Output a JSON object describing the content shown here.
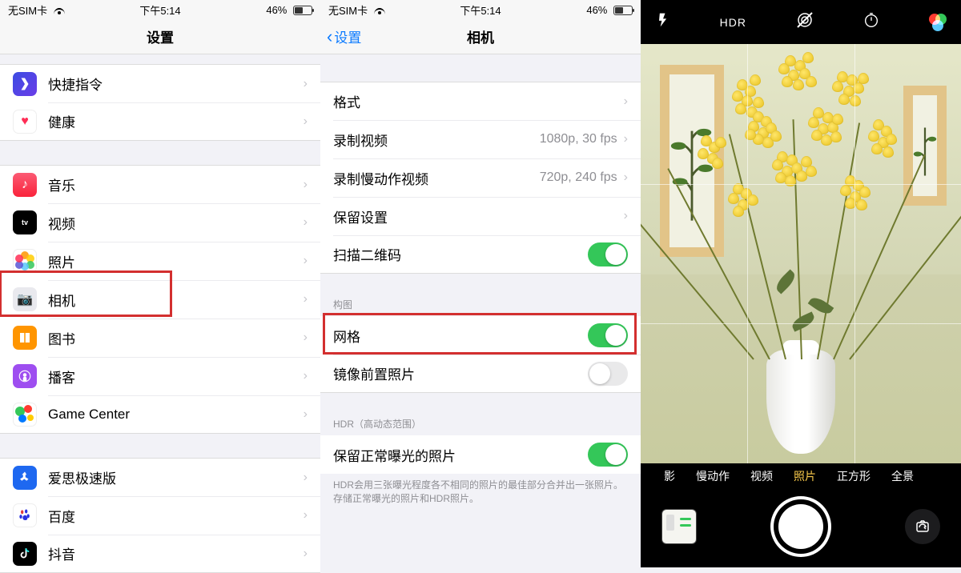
{
  "status": {
    "carrier": "无SIM卡",
    "time": "下午5:14",
    "battery_pct": "46%"
  },
  "panel1": {
    "title": "设置",
    "groups": [
      [
        {
          "icon": "shortcuts",
          "label": "快捷指令"
        },
        {
          "icon": "health",
          "label": "健康"
        }
      ],
      [
        {
          "icon": "music",
          "label": "音乐"
        },
        {
          "icon": "tv",
          "label": "视频"
        },
        {
          "icon": "photos",
          "label": "照片"
        },
        {
          "icon": "camera",
          "label": "相机",
          "highlighted": true
        },
        {
          "icon": "books",
          "label": "图书"
        },
        {
          "icon": "podcasts",
          "label": "播客"
        },
        {
          "icon": "gamecenter",
          "label": "Game Center"
        }
      ],
      [
        {
          "icon": "aisi",
          "label": "爱思极速版"
        },
        {
          "icon": "baidu",
          "label": "百度"
        },
        {
          "icon": "douyin",
          "label": "抖音"
        }
      ]
    ]
  },
  "panel2": {
    "back_label": "设置",
    "title": "相机",
    "sections": {
      "main": [
        {
          "label": "格式",
          "type": "link"
        },
        {
          "label": "录制视频",
          "detail": "1080p, 30 fps",
          "type": "link"
        },
        {
          "label": "录制慢动作视频",
          "detail": "720p, 240 fps",
          "type": "link"
        },
        {
          "label": "保留设置",
          "type": "link"
        },
        {
          "label": "扫描二维码",
          "type": "switch",
          "on": true
        }
      ],
      "composition_header": "构图",
      "composition": [
        {
          "label": "网格",
          "type": "switch",
          "on": true,
          "highlighted": true
        },
        {
          "label": "镜像前置照片",
          "type": "switch",
          "on": false
        }
      ],
      "hdr_header": "HDR（高动态范围）",
      "hdr": [
        {
          "label": "保留正常曝光的照片",
          "type": "switch",
          "on": true
        }
      ],
      "hdr_footer": "HDR会用三张曝光程度各不相同的照片的最佳部分合并出一张照片。存储正常曝光的照片和HDR照片。"
    }
  },
  "panel3": {
    "top_icons": [
      "flash",
      "hdr",
      "live-off",
      "timer",
      "filters"
    ],
    "hdr_label": "HDR",
    "modes_left": "影",
    "modes": [
      "慢动作",
      "视频",
      "照片",
      "正方形",
      "全景"
    ],
    "active_mode": "照片",
    "grid_enabled": true
  }
}
